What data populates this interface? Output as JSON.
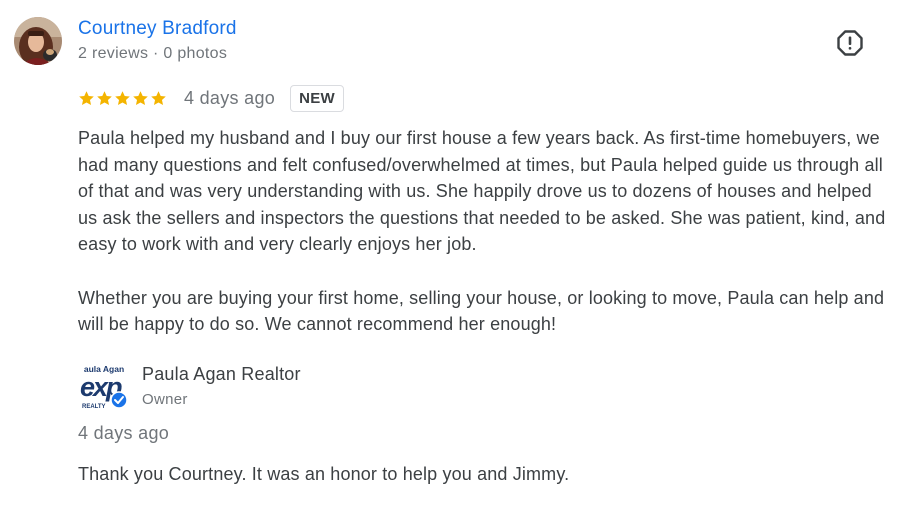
{
  "reviewer": {
    "name": "Courtney Bradford",
    "meta": "2 reviews · 0 photos",
    "avatar_icon": "profile-photo"
  },
  "review": {
    "rating": 5,
    "rating_max": 5,
    "time": "4 days ago",
    "badge": "NEW",
    "paragraphs": [
      "Paula helped my husband and I buy our first house a few years back. As first-time homebuyers, we had many questions and felt confused/overwhelmed at times, but Paula helped guide us through all of that and was very understanding with us. She happily drove us to dozens of houses and helped us ask the sellers and inspectors the questions that needed to be asked. She was patient, kind, and easy to work with and very clearly enjoys her job.",
      "Whether you are buying your first home, selling your house, or looking to move, Paula can help and will be happy to do so. We cannot recommend her enough!"
    ]
  },
  "owner_response": {
    "name": "Paula Agan Realtor",
    "role": "Owner",
    "time": "4 days ago",
    "text": "Thank you Courtney. It was an honor to help you and Jimmy.",
    "logo": {
      "top_text": "aula Agan",
      "main_text": "exp",
      "bottom_text": "REALTY",
      "verified_icon": "verified-check-icon"
    }
  },
  "actions": {
    "report_icon": "report-flag-icon"
  },
  "colors": {
    "link": "#1a73e8",
    "secondary_text": "#70757a",
    "body_text": "#3c4043",
    "star": "#f4b400",
    "verified": "#1a73e8"
  }
}
